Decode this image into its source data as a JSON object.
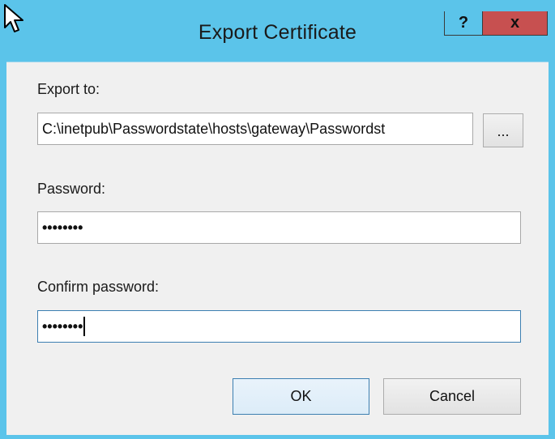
{
  "window": {
    "title": "Export Certificate",
    "help_label": "?",
    "close_label": "x"
  },
  "form": {
    "export_to_label": "Export to:",
    "export_to_value": "C:\\inetpub\\Passwordstate\\hosts\\gateway\\Passwordst",
    "browse_label": "...",
    "password_label": "Password:",
    "password_mask": "••••••••",
    "confirm_label": "Confirm password:",
    "confirm_mask": "••••••••"
  },
  "buttons": {
    "ok_label": "OK",
    "cancel_label": "Cancel"
  },
  "colors": {
    "titlebar": "#5bc4ea",
    "close_button": "#c75050",
    "default_button_border": "#3c7fb1"
  },
  "icons": {
    "cursor": "mouse-pointer-icon"
  }
}
